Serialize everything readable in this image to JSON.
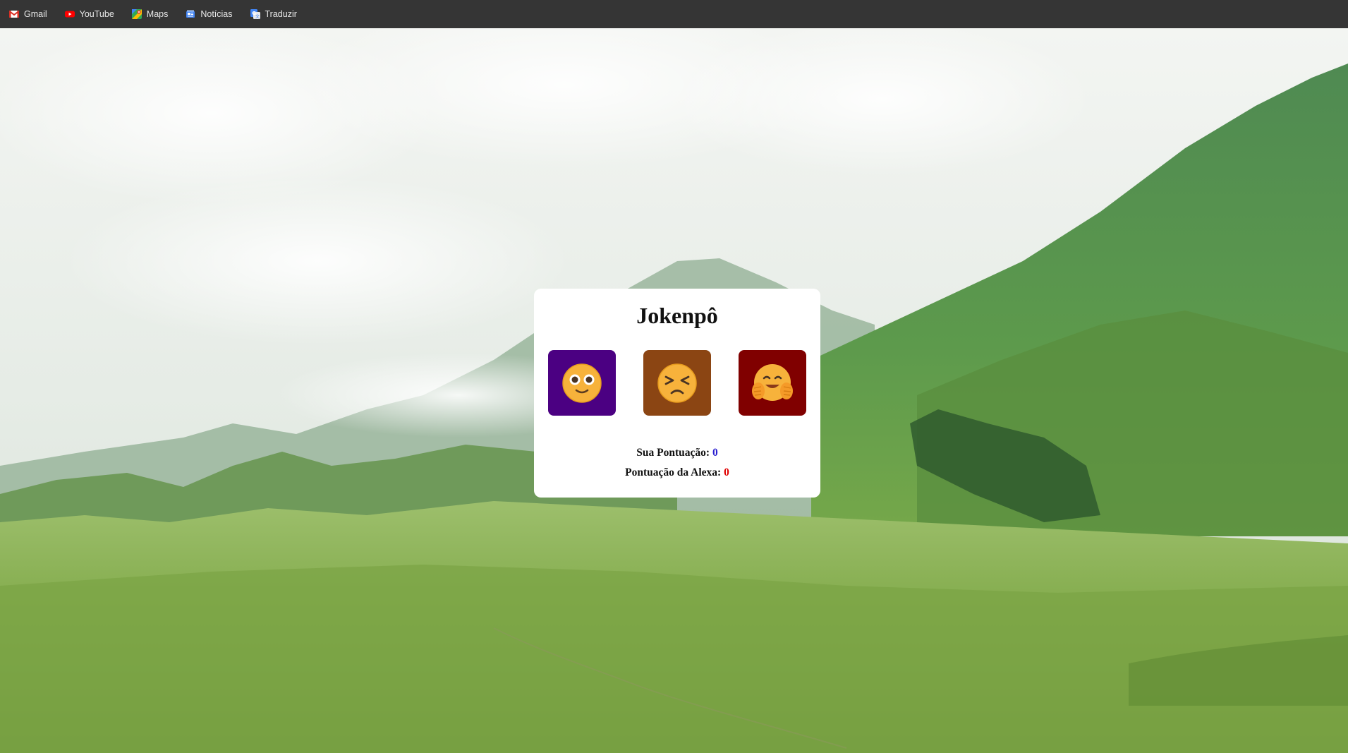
{
  "bookmarks": [
    {
      "label": "Gmail",
      "icon": "gmail-icon"
    },
    {
      "label": "YouTube",
      "icon": "youtube-icon"
    },
    {
      "label": "Maps",
      "icon": "maps-icon"
    },
    {
      "label": "Notícias",
      "icon": "news-icon"
    },
    {
      "label": "Traduzir",
      "icon": "translate-icon"
    }
  ],
  "game": {
    "title": "Jokenpô",
    "choices": [
      {
        "name": "choice-rock",
        "icon": "face-flushed-smile-icon",
        "color": "#4b0082"
      },
      {
        "name": "choice-paper",
        "icon": "face-squinting-icon",
        "color": "#8b4513"
      },
      {
        "name": "choice-scissors",
        "icon": "face-hugging-icon",
        "color": "#800000"
      }
    ],
    "user_score_label": "Sua Pontuação:",
    "user_score": "0",
    "alexa_score_label": "Pontuação da Alexa:",
    "alexa_score": "0"
  },
  "colors": {
    "bookmarks_bar": "#353535",
    "user_score": "#2a1fd0",
    "alexa_score": "#e00000"
  }
}
